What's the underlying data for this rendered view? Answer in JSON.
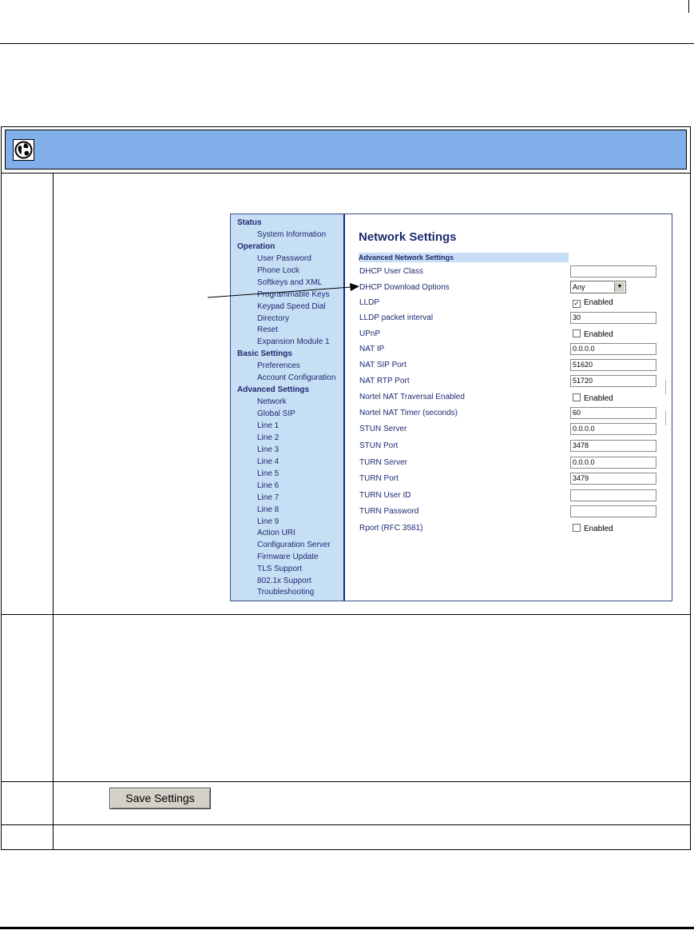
{
  "nav": {
    "status": "Status",
    "system_information": "System Information",
    "operation": "Operation",
    "user_password": "User Password",
    "phone_lock": "Phone Lock",
    "softkeys_xml": "Softkeys and XML",
    "programmable_keys": "Programmable Keys",
    "keypad_speed_dial": "Keypad Speed Dial",
    "directory": "Directory",
    "reset": "Reset",
    "expansion_module_1": "Expansion Module 1",
    "basic_settings": "Basic Settings",
    "preferences": "Preferences",
    "account_configuration": "Account Configuration",
    "advanced_settings": "Advanced Settings",
    "network": "Network",
    "global_sip": "Global SIP",
    "lines": [
      "Line 1",
      "Line 2",
      "Line 3",
      "Line 4",
      "Line 5",
      "Line 6",
      "Line 7",
      "Line 8",
      "Line 9"
    ],
    "action_uri": "Action URI",
    "configuration_server": "Configuration Server",
    "firmware_update": "Firmware Update",
    "tls_support": "TLS Support",
    "dot1x_support": "802.1x Support",
    "troubleshooting": "Troubleshooting"
  },
  "page": {
    "title": "Network Settings",
    "section": "Advanced Network Settings"
  },
  "fields": {
    "dhcp_user_class": {
      "label": "DHCP User Class",
      "value": ""
    },
    "dhcp_download_options": {
      "label": "DHCP Download Options",
      "value": "Any"
    },
    "lldp": {
      "label": "LLDP",
      "checked": true,
      "check_label": "Enabled"
    },
    "lldp_packet_interval": {
      "label": "LLDP packet interval",
      "value": "30"
    },
    "upnp": {
      "label": "UPnP",
      "checked": false,
      "check_label": "Enabled"
    },
    "nat_ip": {
      "label": "NAT IP",
      "value": "0.0.0.0"
    },
    "nat_sip_port": {
      "label": "NAT SIP Port",
      "value": "51620"
    },
    "nat_rtp_port": {
      "label": "NAT RTP Port",
      "value": "51720"
    },
    "nortel_nat_traversal": {
      "label": "Nortel NAT Traversal Enabled",
      "checked": false,
      "check_label": "Enabled"
    },
    "nortel_nat_timer": {
      "label": "Nortel NAT Timer (seconds)",
      "value": "60"
    },
    "stun_server": {
      "label": "STUN Server",
      "value": "0.0.0.0"
    },
    "stun_port": {
      "label": "STUN Port",
      "value": "3478"
    },
    "turn_server": {
      "label": "TURN Server",
      "value": "0.0.0.0"
    },
    "turn_port": {
      "label": "TURN Port",
      "value": "3479"
    },
    "turn_user_id": {
      "label": "TURN User ID",
      "value": ""
    },
    "turn_password": {
      "label": "TURN Password",
      "value": ""
    },
    "rport": {
      "label": "Rport (RFC 3581)",
      "checked": false,
      "check_label": "Enabled"
    }
  },
  "save_button": "Save Settings",
  "checkmark": "✓",
  "select_arrow": "▼",
  "icons": {
    "header": "globe-icon"
  },
  "colors": {
    "header_bar": "#80afe9",
    "nav_bg": "#c6dff5",
    "nav_text": "#1e2a6e"
  }
}
